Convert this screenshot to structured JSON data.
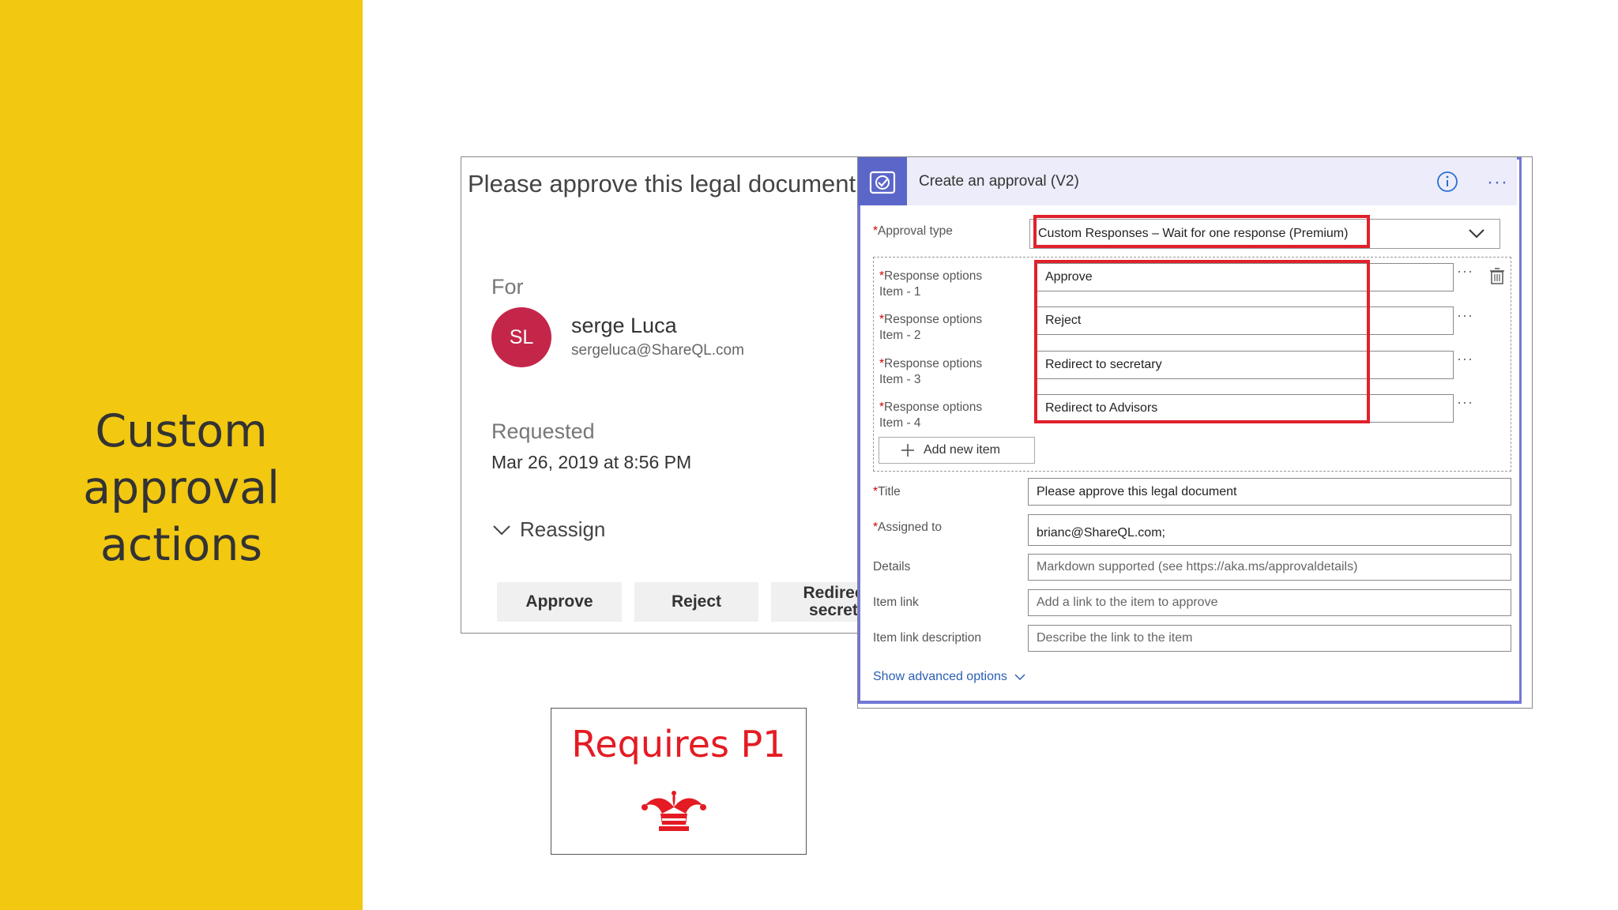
{
  "slide": {
    "title": "Custom approval actions"
  },
  "email": {
    "subject": "Please approve this legal document",
    "for_label": "For",
    "avatar_initials": "SL",
    "user_name": "serge Luca",
    "user_email": "sergeluca@ShareQL.com",
    "requested_label": "Requested",
    "requested_date": "Mar 26, 2019 at 8:56 PM",
    "reassign_label": "Reassign",
    "buttons": {
      "approve": "Approve",
      "reject": "Reject",
      "redirect": "Redirec\nsecret"
    }
  },
  "approval": {
    "header_title": "Create an approval (V2)",
    "approval_type_label": "Approval type",
    "approval_type_value": "Custom Responses – Wait for one response (Premium)",
    "response_options": [
      {
        "label_line1": "Response options",
        "label_line2": "Item - 1",
        "value": "Approve"
      },
      {
        "label_line1": "Response options",
        "label_line2": "Item - 2",
        "value": "Reject"
      },
      {
        "label_line1": "Response options",
        "label_line2": "Item - 3",
        "value": "Redirect to secretary"
      },
      {
        "label_line1": "Response options",
        "label_line2": "Item - 4",
        "value": "Redirect to Advisors"
      }
    ],
    "add_new_item_label": "Add new item",
    "fields": {
      "title_label": "Title",
      "title_value": "Please approve this legal document",
      "assigned_label": "Assigned to",
      "assigned_value": "brianc@ShareQL.com;",
      "details_label": "Details",
      "details_placeholder": "Markdown supported (see https://aka.ms/approvaldetails)",
      "item_link_label": "Item link",
      "item_link_placeholder": "Add a link to the item to approve",
      "item_link_desc_label": "Item link description",
      "item_link_desc_placeholder": "Describe the link to the item"
    },
    "show_advanced_label": "Show advanced options"
  },
  "callout": {
    "text": "Requires P1"
  },
  "colors": {
    "sidebar": "#f2c811",
    "accent": "#5b66c9",
    "highlight": "#e0212c",
    "avatar": "#c4264a"
  }
}
